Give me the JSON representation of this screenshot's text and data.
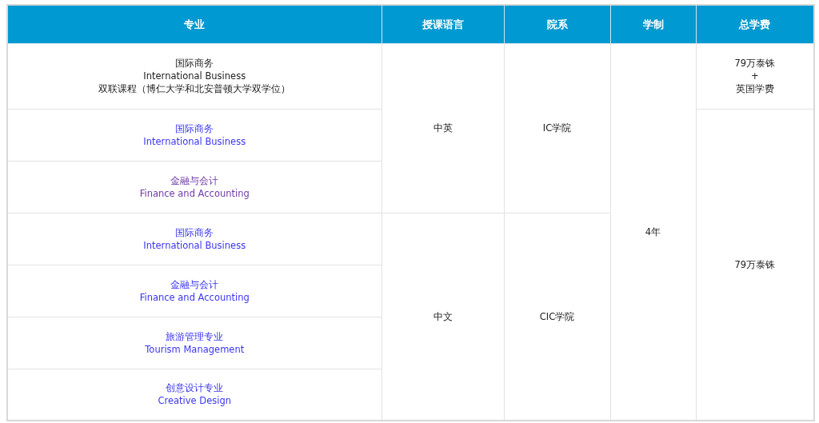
{
  "columns": [
    "专业",
    "授课语言",
    "院系",
    "学制",
    "总学费"
  ],
  "duration": "4年",
  "groups": [
    {
      "language": "中英",
      "department": "IC学院",
      "majors": [
        {
          "kind": "text",
          "name_cn": "国际商务",
          "name_en": "International Business",
          "note": "双联课程（博仁大学和北安普顿大学双学位）",
          "fee": [
            "79万泰铢",
            "+",
            "英国学费"
          ]
        },
        {
          "kind": "link",
          "visited": false,
          "name_cn": "国际商务",
          "name_en": "International Business",
          "fee": [
            "79万泰铢"
          ]
        },
        {
          "kind": "link",
          "visited": true,
          "name_cn": "金融与会计",
          "name_en": "Finance and Accounting"
        }
      ]
    },
    {
      "language": "中文",
      "department": "CIC学院",
      "majors": [
        {
          "kind": "link",
          "visited": false,
          "name_cn": "国际商务",
          "name_en": "International Business"
        },
        {
          "kind": "link",
          "visited": false,
          "name_cn": "金融与会计",
          "name_en": "Finance and Accounting"
        },
        {
          "kind": "link",
          "visited": false,
          "name_cn": "旅游管理专业",
          "name_en": "Tourism Management"
        },
        {
          "kind": "link",
          "visited": false,
          "name_cn": "创意设计专业",
          "name_en": "Creative Design"
        }
      ]
    }
  ]
}
